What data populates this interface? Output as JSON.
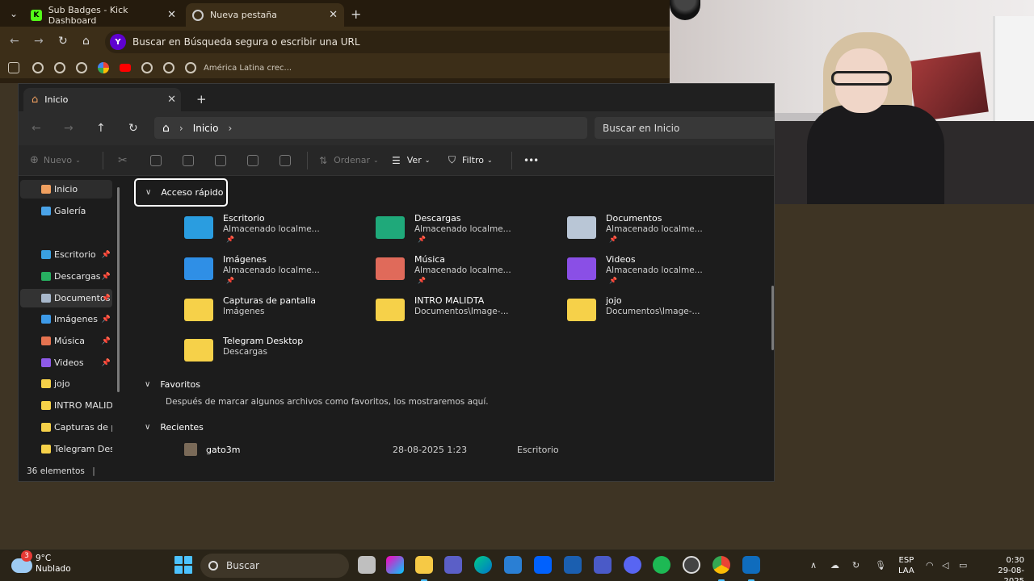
{
  "browser": {
    "tabs": [
      {
        "title": "Sub Badges - Kick Dashboard",
        "favicon": "K"
      },
      {
        "title": "Nueva pestaña"
      }
    ],
    "omnibox_text": "Buscar en Búsqueda segura o escribir una URL",
    "search_badge": "Y",
    "bookmark_label": "América Latina crec..."
  },
  "explorer": {
    "tab_title": "Inicio",
    "breadcrumb": "Inicio",
    "search_placeholder": "Buscar en Inicio",
    "toolbar": {
      "new": "Nuevo",
      "sort": "Ordenar",
      "view": "Ver",
      "filter": "Filtro",
      "more": "•••"
    },
    "sidebar": [
      {
        "label": "Inicio",
        "color": "#f0a060",
        "pinned": false
      },
      {
        "label": "Galería",
        "color": "#4aa3e8",
        "pinned": false
      },
      {
        "label": "Escritorio",
        "color": "#3aa0e0",
        "pinned": true
      },
      {
        "label": "Descargas",
        "color": "#27ae60",
        "pinned": true
      },
      {
        "label": "Documentos",
        "color": "#a8b8cc",
        "pinned": true
      },
      {
        "label": "Imágenes",
        "color": "#3d9ae8",
        "pinned": true
      },
      {
        "label": "Música",
        "color": "#e57350",
        "pinned": true
      },
      {
        "label": "Videos",
        "color": "#8e5ae8",
        "pinned": true
      },
      {
        "label": "jojo",
        "color": "#f6d149",
        "pinned": false
      },
      {
        "label": "INTRO MALIDTA",
        "color": "#f6d149",
        "pinned": false
      },
      {
        "label": "Capturas de pantalla",
        "color": "#f6d149",
        "pinned": false
      },
      {
        "label": "Telegram Desktop",
        "color": "#f6d149",
        "pinned": false
      }
    ],
    "quick_access": {
      "title": "Acceso rápido",
      "items": [
        {
          "name": "Escritorio",
          "sub": "Almacenado localme...",
          "pinned": true,
          "color": "#2a9de0"
        },
        {
          "name": "Descargas",
          "sub": "Almacenado localme...",
          "pinned": true,
          "color": "#1fa97a"
        },
        {
          "name": "Documentos",
          "sub": "Almacenado localme...",
          "pinned": true,
          "color": "#b9c6d6"
        },
        {
          "name": "Imágenes",
          "sub": "Almacenado localme...",
          "pinned": true,
          "color": "#2f8fe6"
        },
        {
          "name": "Música",
          "sub": "Almacenado localme...",
          "pinned": true,
          "color": "#e06a5a"
        },
        {
          "name": "Videos",
          "sub": "Almacenado localme...",
          "pinned": true,
          "color": "#8a4fe6"
        },
        {
          "name": "Capturas de pantalla",
          "sub": "Imágenes",
          "pinned": false,
          "color": "#f6d149"
        },
        {
          "name": "INTRO MALIDTA",
          "sub": "Documentos\\Image-...",
          "pinned": false,
          "color": "#f6d149"
        },
        {
          "name": "jojo",
          "sub": "Documentos\\Image-...",
          "pinned": false,
          "color": "#f6d149"
        },
        {
          "name": "Telegram Desktop",
          "sub": "Descargas",
          "pinned": false,
          "color": "#f6d149"
        }
      ]
    },
    "favorites": {
      "title": "Favoritos",
      "note": "Después de marcar algunos archivos como favoritos, los mostraremos aquí."
    },
    "recent": {
      "title": "Recientes",
      "items": [
        {
          "name": "gato3m",
          "date": "28-08-2025 1:23",
          "location": "Escritorio"
        }
      ]
    },
    "status": "36 elementos"
  },
  "taskbar": {
    "weather_temp": "9°C",
    "weather_desc": "Nublado",
    "weather_badge": "3",
    "search_label": "Buscar",
    "lang_line1": "ESP",
    "lang_line2": "LAA",
    "time": "0:30",
    "date": "29-08-2025",
    "accent": "#4cc2ff"
  }
}
